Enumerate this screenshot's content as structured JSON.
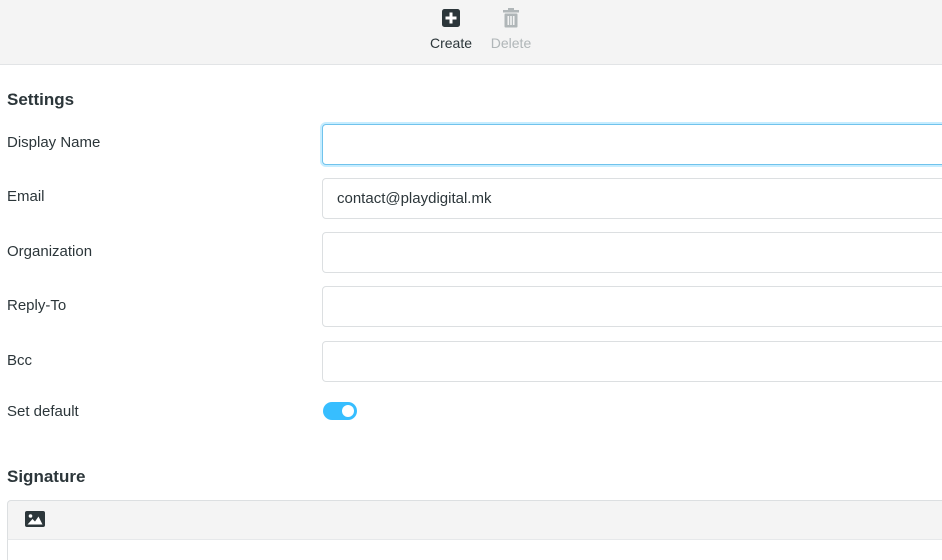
{
  "toolbar": {
    "create_label": "Create",
    "delete_label": "Delete",
    "create_icon": "plus-square-icon",
    "delete_icon": "trash-icon"
  },
  "settings": {
    "title": "Settings",
    "display_name": {
      "label": "Display Name",
      "value": ""
    },
    "email": {
      "label": "Email",
      "value": "contact@playdigital.mk"
    },
    "organization": {
      "label": "Organization",
      "value": ""
    },
    "reply_to": {
      "label": "Reply-To",
      "value": ""
    },
    "bcc": {
      "label": "Bcc",
      "value": ""
    },
    "set_default": {
      "label": "Set default",
      "enabled": true
    }
  },
  "signature": {
    "title": "Signature",
    "image_icon": "image-icon"
  },
  "colors": {
    "accent": "#37beff",
    "text": "#2c363a",
    "disabled": "#b0b6b8",
    "toolbar_bg": "#f4f4f4"
  }
}
